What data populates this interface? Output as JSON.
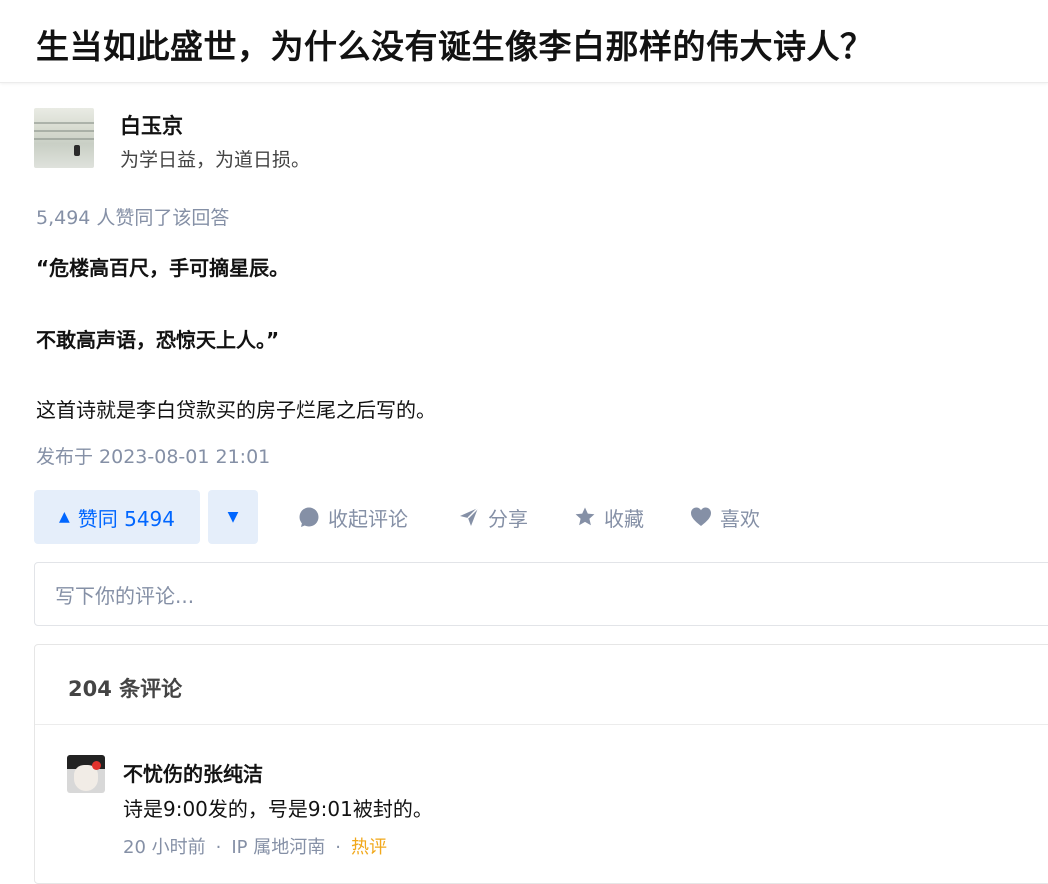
{
  "question": {
    "title": "生当如此盛世，为什么没有诞生像李白那样的伟大诗人？"
  },
  "author": {
    "name": "白玉京",
    "bio": "为学日益，为道日损。"
  },
  "answer": {
    "vote_summary": "5,494 人赞同了该回答",
    "paragraphs": [
      "“危楼高百尺，手可摘星辰。",
      "不敢高声语，恐惊天上人。”",
      "这首诗就是李白贷款买的房子烂尾之后写的。"
    ],
    "published": "发布于 2023-08-01 21:01"
  },
  "actions": {
    "vote_up_label": "赞同 5494",
    "vote_up_icon": "▲",
    "vote_down_icon": "▼",
    "collapse_comments": "收起评论",
    "share": "分享",
    "favorite": "收藏",
    "like": "喜欢"
  },
  "comment_input": {
    "placeholder": "写下你的评论..."
  },
  "comments": {
    "count_label": "204 条评论",
    "items": [
      {
        "name": "不忧伤的张纯洁",
        "text": "诗是9:00发的，号是9:01被封的。",
        "time": "20 小时前",
        "location": "IP 属地河南",
        "tag": "热评"
      }
    ]
  },
  "colors": {
    "accent": "#0066ff",
    "muted": "#8590a6",
    "hot": "#f1a81b"
  }
}
